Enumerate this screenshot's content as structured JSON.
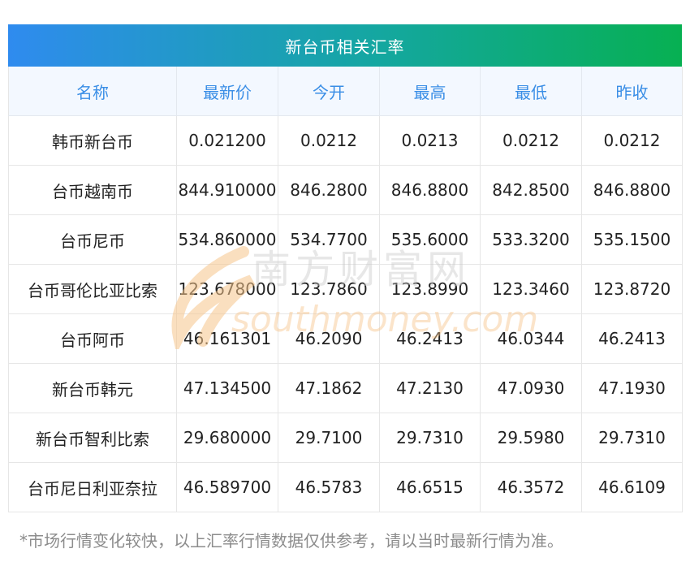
{
  "title": "新台币相关汇率",
  "headers": [
    "名称",
    "最新价",
    "今开",
    "最高",
    "最低",
    "昨收"
  ],
  "rows": [
    {
      "name": "韩币新台币",
      "latest": "0.021200",
      "open": "0.0212",
      "high": "0.0213",
      "low": "0.0212",
      "prev_close": "0.0212"
    },
    {
      "name": "台币越南币",
      "latest": "844.910000",
      "open": "846.2800",
      "high": "846.8800",
      "low": "842.8500",
      "prev_close": "846.8800"
    },
    {
      "name": "台币尼币",
      "latest": "534.860000",
      "open": "534.7700",
      "high": "535.6000",
      "low": "533.3200",
      "prev_close": "535.1500"
    },
    {
      "name": "台币哥伦比亚比索",
      "latest": "123.678000",
      "open": "123.7860",
      "high": "123.8990",
      "low": "123.3460",
      "prev_close": "123.8720"
    },
    {
      "name": "台币阿币",
      "latest": "46.161301",
      "open": "46.2090",
      "high": "46.2413",
      "low": "46.0344",
      "prev_close": "46.2413"
    },
    {
      "name": "新台币韩元",
      "latest": "47.134500",
      "open": "47.1862",
      "high": "47.2130",
      "low": "47.0930",
      "prev_close": "47.1930"
    },
    {
      "name": "新台币智利比索",
      "latest": "29.680000",
      "open": "29.7100",
      "high": "29.7310",
      "low": "29.5980",
      "prev_close": "29.7310"
    },
    {
      "name": "台币尼日利亚奈拉",
      "latest": "46.589700",
      "open": "46.5783",
      "high": "46.6515",
      "low": "46.3572",
      "prev_close": "46.6109"
    }
  ],
  "watermark": {
    "cn": "南方财富网",
    "en": "southmoney.com"
  },
  "footnote": "*市场行情变化较快，以上汇率行情数据仅供参考，请以当时最新行情为准。",
  "colors": {
    "title_gradient_start": "#2f8bef",
    "title_gradient_end": "#07b052",
    "header_text": "#3a8ee6",
    "header_bg": "#f3f8ff"
  }
}
